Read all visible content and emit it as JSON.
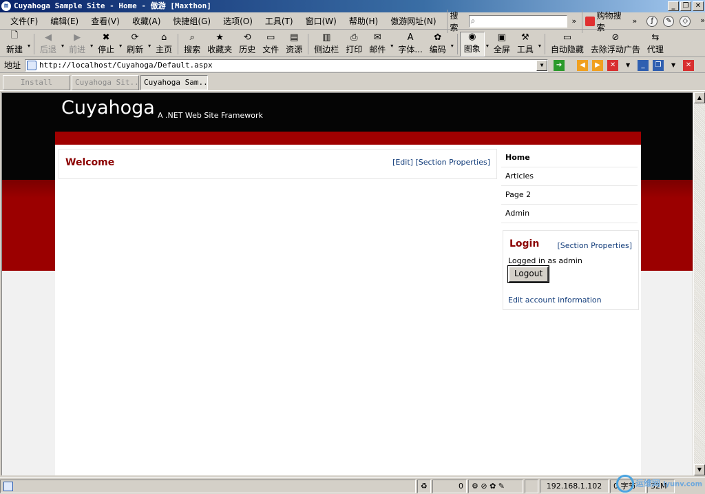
{
  "window": {
    "app_icon_letter": "m",
    "title": "Cuyahoga Sample Site - Home - 傲游 [Maxthon]",
    "buttons": [
      "_",
      "❐",
      "✕"
    ]
  },
  "menu": {
    "items": [
      "文件(F)",
      "编辑(E)",
      "查看(V)",
      "收藏(A)",
      "快捷组(G)",
      "选项(O)",
      "工具(T)",
      "窗口(W)",
      "帮助(H)",
      "傲游网址(N)"
    ],
    "search_label": "搜索",
    "search_value": "",
    "shop_label": "购物搜索"
  },
  "toolbar": {
    "items": [
      {
        "label": "新建",
        "icon": "new-page-icon",
        "glyph": "🗋",
        "drop": true
      },
      {
        "label": "后退",
        "icon": "back-arrow-icon",
        "glyph": "◀",
        "disabled": true,
        "drop": true
      },
      {
        "label": "前进",
        "icon": "forward-arrow-icon",
        "glyph": "▶",
        "disabled": true,
        "drop": true
      },
      {
        "label": "停止",
        "icon": "stop-icon",
        "glyph": "✖",
        "drop": true
      },
      {
        "label": "刷新",
        "icon": "refresh-icon",
        "glyph": "⟳",
        "drop": true
      },
      {
        "label": "主页",
        "icon": "home-icon",
        "glyph": "⌂"
      },
      {
        "label": "搜索",
        "icon": "search-icon",
        "glyph": "⌕"
      },
      {
        "label": "收藏夹",
        "icon": "favorites-star-icon",
        "glyph": "★"
      },
      {
        "label": "历史",
        "icon": "history-icon",
        "glyph": "⟲"
      },
      {
        "label": "文件",
        "icon": "folder-icon",
        "glyph": "▭"
      },
      {
        "label": "资源",
        "icon": "resources-icon",
        "glyph": "▤"
      },
      {
        "label": "侧边栏",
        "icon": "sidebar-icon",
        "glyph": "▥"
      },
      {
        "label": "打印",
        "icon": "printer-icon",
        "glyph": "⎙"
      },
      {
        "label": "邮件",
        "icon": "mail-icon",
        "glyph": "✉",
        "drop": true
      },
      {
        "label": "字体...",
        "icon": "font-icon",
        "glyph": "A"
      },
      {
        "label": "编码",
        "icon": "encoding-icon",
        "glyph": "✿",
        "drop": true
      },
      {
        "label": "图象",
        "icon": "image-icon",
        "glyph": "◉",
        "active": true,
        "drop": true
      },
      {
        "label": "全屏",
        "icon": "fullscreen-icon",
        "glyph": "▣"
      },
      {
        "label": "工具",
        "icon": "tools-icon",
        "glyph": "⚒",
        "drop": true
      },
      {
        "label": "自动隐藏",
        "icon": "autohide-icon",
        "glyph": "▭"
      },
      {
        "label": "去除浮动广告",
        "icon": "remove-ads-icon",
        "glyph": "⊘"
      },
      {
        "label": "代理",
        "icon": "proxy-icon",
        "glyph": "⇆"
      }
    ]
  },
  "address": {
    "label": "地址",
    "url": "http://localhost/Cuyahoga/Default.aspx"
  },
  "tabs": [
    {
      "label": "Install",
      "active": false
    },
    {
      "label": "Cuyahoga Sit...",
      "active": false
    },
    {
      "label": "Cuyahoga Sam...",
      "active": true
    }
  ],
  "site": {
    "title": "Cuyahoga",
    "tagline": "A .NET Web Site Framework",
    "welcome": {
      "title": "Welcome",
      "edit_link": "[Edit]",
      "section_props_link": "[Section Properties]"
    },
    "nav": [
      "Home",
      "Articles",
      "Page 2",
      "Admin"
    ],
    "login": {
      "title": "Login",
      "section_props_link": "[Section Properties]",
      "status": "Logged in as admin",
      "logout_label": "Logout",
      "edit_account_link": "Edit account information"
    },
    "colors": {
      "header_black": "#050505",
      "header_red": "#9b0000",
      "heading_red": "#8b0000",
      "link_blue": "#123c7a"
    }
  },
  "status_bar": {
    "counter": "0",
    "ip": "192.168.1.102",
    "bytes": "0 字节",
    "memory": "32M"
  },
  "watermark": {
    "text": "运维网",
    "subtext": "iyunv.com"
  }
}
